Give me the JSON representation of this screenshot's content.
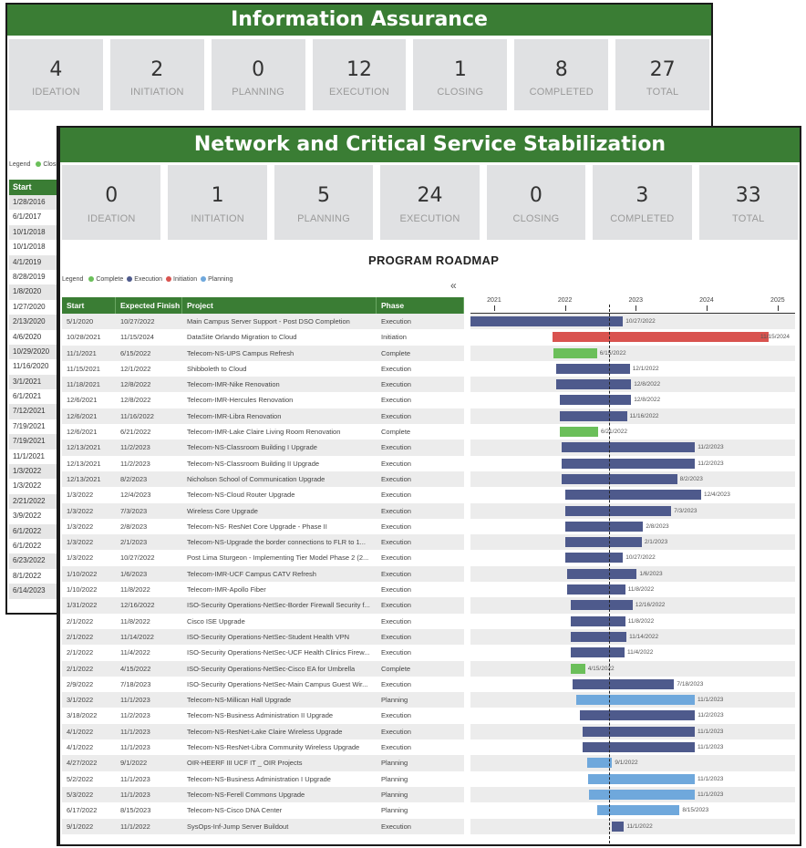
{
  "back_panel": {
    "title": "Information Assurance",
    "kpis": [
      {
        "value": "4",
        "label": "IDEATION"
      },
      {
        "value": "2",
        "label": "INITIATION"
      },
      {
        "value": "0",
        "label": "PLANNING"
      },
      {
        "value": "12",
        "label": "EXECUTION"
      },
      {
        "value": "1",
        "label": "CLOSING"
      },
      {
        "value": "8",
        "label": "COMPLETED"
      },
      {
        "value": "27",
        "label": "TOTAL"
      }
    ],
    "legend_label": "Legend",
    "legend_first": "Closin",
    "start_header": "Start",
    "start_dates": [
      "1/28/2016",
      "6/1/2017",
      "10/1/2018",
      "10/1/2018",
      "4/1/2019",
      "8/28/2019",
      "1/8/2020",
      "1/27/2020",
      "2/13/2020",
      "4/6/2020",
      "10/29/2020",
      "11/16/2020",
      "3/1/2021",
      "6/1/2021",
      "7/12/2021",
      "7/19/2021",
      "7/19/2021",
      "11/1/2021",
      "1/3/2022",
      "1/3/2022",
      "2/21/2022",
      "3/9/2022",
      "6/1/2022",
      "6/1/2022",
      "6/23/2022",
      "8/1/2022",
      "6/14/2023"
    ]
  },
  "front_panel": {
    "title": "Network and Critical Service Stabilization",
    "kpis": [
      {
        "value": "0",
        "label": "IDEATION"
      },
      {
        "value": "1",
        "label": "INITIATION"
      },
      {
        "value": "5",
        "label": "PLANNING"
      },
      {
        "value": "24",
        "label": "EXECUTION"
      },
      {
        "value": "0",
        "label": "CLOSING"
      },
      {
        "value": "3",
        "label": "COMPLETED"
      },
      {
        "value": "33",
        "label": "TOTAL"
      }
    ],
    "roadmap_title": "PROGRAM ROADMAP",
    "legend": {
      "label": "Legend",
      "items": [
        {
          "name": "Complete",
          "color": "#6bbf5a"
        },
        {
          "name": "Execution",
          "color": "#4e5a8c"
        },
        {
          "name": "Initiation",
          "color": "#d9534f"
        },
        {
          "name": "Planning",
          "color": "#6fa8dc"
        }
      ]
    },
    "collapse_icon": "«",
    "columns": [
      "Start",
      "Expected Finish",
      "Project",
      "Phase"
    ],
    "phase_colors": {
      "Execution": "#4e5a8c",
      "Initiation": "#d9534f",
      "Complete": "#6bbf5a",
      "Planning": "#6fa8dc"
    },
    "axis_years": [
      "2021",
      "2022",
      "2023",
      "2024",
      "2025"
    ],
    "rows": [
      {
        "start": "5/1/2020",
        "finish": "10/27/2022",
        "project": "Main Campus Server Support - Post DSO Completion",
        "phase": "Execution"
      },
      {
        "start": "10/28/2021",
        "finish": "11/15/2024",
        "project": "DataSite Orlando Migration to Cloud",
        "phase": "Initiation"
      },
      {
        "start": "11/1/2021",
        "finish": "6/15/2022",
        "project": "Telecom-NS-UPS Campus Refresh",
        "phase": "Complete"
      },
      {
        "start": "11/15/2021",
        "finish": "12/1/2022",
        "project": "Shibboleth to Cloud",
        "phase": "Execution"
      },
      {
        "start": "11/18/2021",
        "finish": "12/8/2022",
        "project": "Telecom-IMR-Nike Renovation",
        "phase": "Execution"
      },
      {
        "start": "12/6/2021",
        "finish": "12/8/2022",
        "project": "Telecom-IMR-Hercules Renovation",
        "phase": "Execution"
      },
      {
        "start": "12/6/2021",
        "finish": "11/16/2022",
        "project": "Telecom-IMR-Libra Renovation",
        "phase": "Execution"
      },
      {
        "start": "12/6/2021",
        "finish": "6/21/2022",
        "project": "Telecom-IMR-Lake Claire Living Room Renovation",
        "phase": "Complete"
      },
      {
        "start": "12/13/2021",
        "finish": "11/2/2023",
        "project": "Telecom-NS-Classroom Building I Upgrade",
        "phase": "Execution"
      },
      {
        "start": "12/13/2021",
        "finish": "11/2/2023",
        "project": "Telecom-NS-Classroom Building II Upgrade",
        "phase": "Execution"
      },
      {
        "start": "12/13/2021",
        "finish": "8/2/2023",
        "project": "Nicholson School of Communication Upgrade",
        "phase": "Execution"
      },
      {
        "start": "1/3/2022",
        "finish": "12/4/2023",
        "project": "Telecom-NS-Cloud Router Upgrade",
        "phase": "Execution"
      },
      {
        "start": "1/3/2022",
        "finish": "7/3/2023",
        "project": "Wireless Core Upgrade",
        "phase": "Execution"
      },
      {
        "start": "1/3/2022",
        "finish": "2/8/2023",
        "project": "Telecom-NS- ResNet Core Upgrade - Phase II",
        "phase": "Execution"
      },
      {
        "start": "1/3/2022",
        "finish": "2/1/2023",
        "project": "Telecom-NS-Upgrade the border connections to FLR to 1...",
        "phase": "Execution"
      },
      {
        "start": "1/3/2022",
        "finish": "10/27/2022",
        "project": "Post Lima Sturgeon - Implementing Tier Model Phase 2 (2...",
        "phase": "Execution"
      },
      {
        "start": "1/10/2022",
        "finish": "1/6/2023",
        "project": "Telecom-IMR-UCF Campus CATV Refresh",
        "phase": "Execution"
      },
      {
        "start": "1/10/2022",
        "finish": "11/8/2022",
        "project": "Telecom-IMR-Apollo Fiber",
        "phase": "Execution"
      },
      {
        "start": "1/31/2022",
        "finish": "12/16/2022",
        "project": "ISO-Security Operations-NetSec-Border Firewall Security f...",
        "phase": "Execution"
      },
      {
        "start": "2/1/2022",
        "finish": "11/8/2022",
        "project": "Cisco ISE Upgrade",
        "phase": "Execution"
      },
      {
        "start": "2/1/2022",
        "finish": "11/14/2022",
        "project": "ISO-Security Operations-NetSec-Student Health VPN",
        "phase": "Execution"
      },
      {
        "start": "2/1/2022",
        "finish": "11/4/2022",
        "project": "ISO-Security Operations-NetSec-UCF Health Clinics Firew...",
        "phase": "Execution"
      },
      {
        "start": "2/1/2022",
        "finish": "4/15/2022",
        "project": "ISO-Security Operations-NetSec-Cisco EA for Umbrella",
        "phase": "Complete"
      },
      {
        "start": "2/9/2022",
        "finish": "7/18/2023",
        "project": "ISO-Security Operations-NetSec-Main Campus Guest Wir...",
        "phase": "Execution"
      },
      {
        "start": "3/1/2022",
        "finish": "11/1/2023",
        "project": "Telecom-NS-Millican Hall Upgrade",
        "phase": "Planning"
      },
      {
        "start": "3/18/2022",
        "finish": "11/2/2023",
        "project": "Telecom-NS-Business Administration II Upgrade",
        "phase": "Execution"
      },
      {
        "start": "4/1/2022",
        "finish": "11/1/2023",
        "project": "Telecom-NS-ResNet-Lake Claire Wireless Upgrade",
        "phase": "Execution"
      },
      {
        "start": "4/1/2022",
        "finish": "11/1/2023",
        "project": "Telecom-NS-ResNet-Libra Community Wireless Upgrade",
        "phase": "Execution"
      },
      {
        "start": "4/27/2022",
        "finish": "9/1/2022",
        "project": "OIR-HEERF III UCF IT _ OIR Projects",
        "phase": "Planning"
      },
      {
        "start": "5/2/2022",
        "finish": "11/1/2023",
        "project": "Telecom-NS-Business Administration I Upgrade",
        "phase": "Planning"
      },
      {
        "start": "5/3/2022",
        "finish": "11/1/2023",
        "project": "Telecom-NS-Ferell Commons Upgrade",
        "phase": "Planning"
      },
      {
        "start": "6/17/2022",
        "finish": "8/15/2023",
        "project": "Telecom-NS-Cisco DNA Center",
        "phase": "Planning"
      },
      {
        "start": "9/1/2022",
        "finish": "11/1/2022",
        "project": "SysOps-Inf-Jump Server Buildout",
        "phase": "Execution"
      }
    ]
  }
}
